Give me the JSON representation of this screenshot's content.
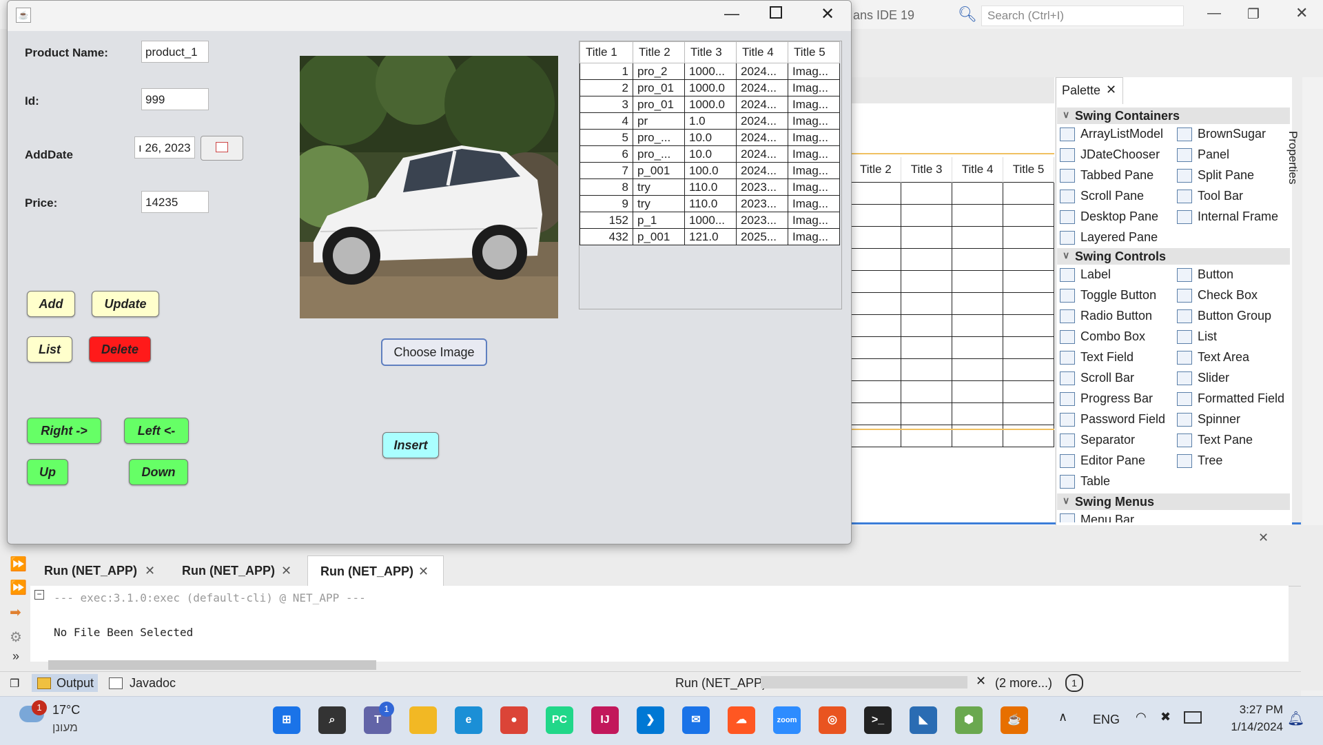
{
  "ide": {
    "title_fragment": "ans IDE 19",
    "search_placeholder": "Search (Ctrl+I)"
  },
  "editor_preview": {
    "headers": [
      "Title 2",
      "Title 3",
      "Title 4",
      "Title 5"
    ]
  },
  "palette": {
    "tab_label": "Palette",
    "sections": [
      {
        "title": "Swing Containers",
        "items": [
          "ArrayListModel",
          "BrownSugar",
          "JDateChooser",
          "Panel",
          "Tabbed Pane",
          "Split Pane",
          "Scroll Pane",
          "Tool Bar",
          "Desktop Pane",
          "Internal Frame",
          "Layered Pane"
        ]
      },
      {
        "title": "Swing Controls",
        "items": [
          "Label",
          "Button",
          "Toggle Button",
          "Check Box",
          "Radio Button",
          "Button Group",
          "Combo Box",
          "List",
          "Text Field",
          "Text Area",
          "Scroll Bar",
          "Slider",
          "Progress Bar",
          "Formatted Field",
          "Password Field",
          "Spinner",
          "Separator",
          "Text Pane",
          "Editor Pane",
          "Tree",
          "Table"
        ]
      },
      {
        "title": "Swing Menus",
        "items": [
          "Menu Bar"
        ]
      }
    ],
    "properties_label": "Properties"
  },
  "output": {
    "tabs": [
      "Run (NET_APP)",
      "Run (NET_APP)",
      "Run (NET_APP)"
    ],
    "lines": [
      "--- exec:3.1.0:exec (default-cli) @ NET_APP ---",
      "No File Been Selected"
    ]
  },
  "status": {
    "output_tab": "Output",
    "javadoc_tab": "Javadoc",
    "run_label": "Run (NET_APP)",
    "more": "(2 more...)"
  },
  "app": {
    "labels": {
      "name": "Product Name:",
      "id": "Id:",
      "date": "AddDate",
      "price": "Price:"
    },
    "fields": {
      "name": "product_1",
      "id": "999",
      "date": "ı 26, 2023",
      "price": "14235"
    },
    "buttons": {
      "add": "Add",
      "update": "Update",
      "list": "List",
      "delete": "Delete",
      "right": "Right ->",
      "left": "Left <-",
      "up": "Up",
      "down": "Down",
      "choose": "Choose Image",
      "insert": "Insert"
    },
    "colors": {
      "yellow_btn": "#ffffcc",
      "delete_btn": "#ff1a1a",
      "green_btn": "#66ff66",
      "insert_btn": "#aaffff"
    },
    "table": {
      "headers": [
        "Title 1",
        "Title 2",
        "Title 3",
        "Title 4",
        "Title 5"
      ],
      "rows": [
        [
          "1",
          "pro_2",
          "1000...",
          "2024...",
          "Imag..."
        ],
        [
          "2",
          "pro_01",
          "1000.0",
          "2024...",
          "Imag..."
        ],
        [
          "3",
          "pro_01",
          "1000.0",
          "2024...",
          "Imag..."
        ],
        [
          "4",
          "pr",
          "1.0",
          "2024...",
          "Imag..."
        ],
        [
          "5",
          "pro_...",
          "10.0",
          "2024...",
          "Imag..."
        ],
        [
          "6",
          "pro_...",
          "10.0",
          "2024...",
          "Imag..."
        ],
        [
          "7",
          "p_001",
          "100.0",
          "2024...",
          "Imag..."
        ],
        [
          "8",
          "try",
          "110.0",
          "2023...",
          "Imag..."
        ],
        [
          "9",
          "try",
          "110.0",
          "2023...",
          "Imag..."
        ],
        [
          "152",
          "p_1",
          "1000...",
          "2023...",
          "Imag..."
        ],
        [
          "432",
          "p_001",
          "121.0",
          "2025...",
          "Imag..."
        ]
      ]
    }
  },
  "taskbar": {
    "weather_temp": "17°C",
    "weather_loc": "מעונן",
    "weather_badge": "1",
    "teams_badge": "1",
    "lang": "ENG",
    "time": "3:27 PM",
    "date": "1/14/2024",
    "icons": [
      "windows-start-icon",
      "search-icon",
      "teams-icon",
      "file-explorer-icon",
      "edge-icon",
      "chrome-icon",
      "pycharm-icon",
      "intellij-icon",
      "vscode-icon",
      "mail-icon",
      "soundcloud-icon",
      "zoom-icon",
      "ubuntu-icon",
      "terminal-icon",
      "apache-netbeans-icon",
      "netbeans-cube-icon",
      "java-icon"
    ]
  }
}
